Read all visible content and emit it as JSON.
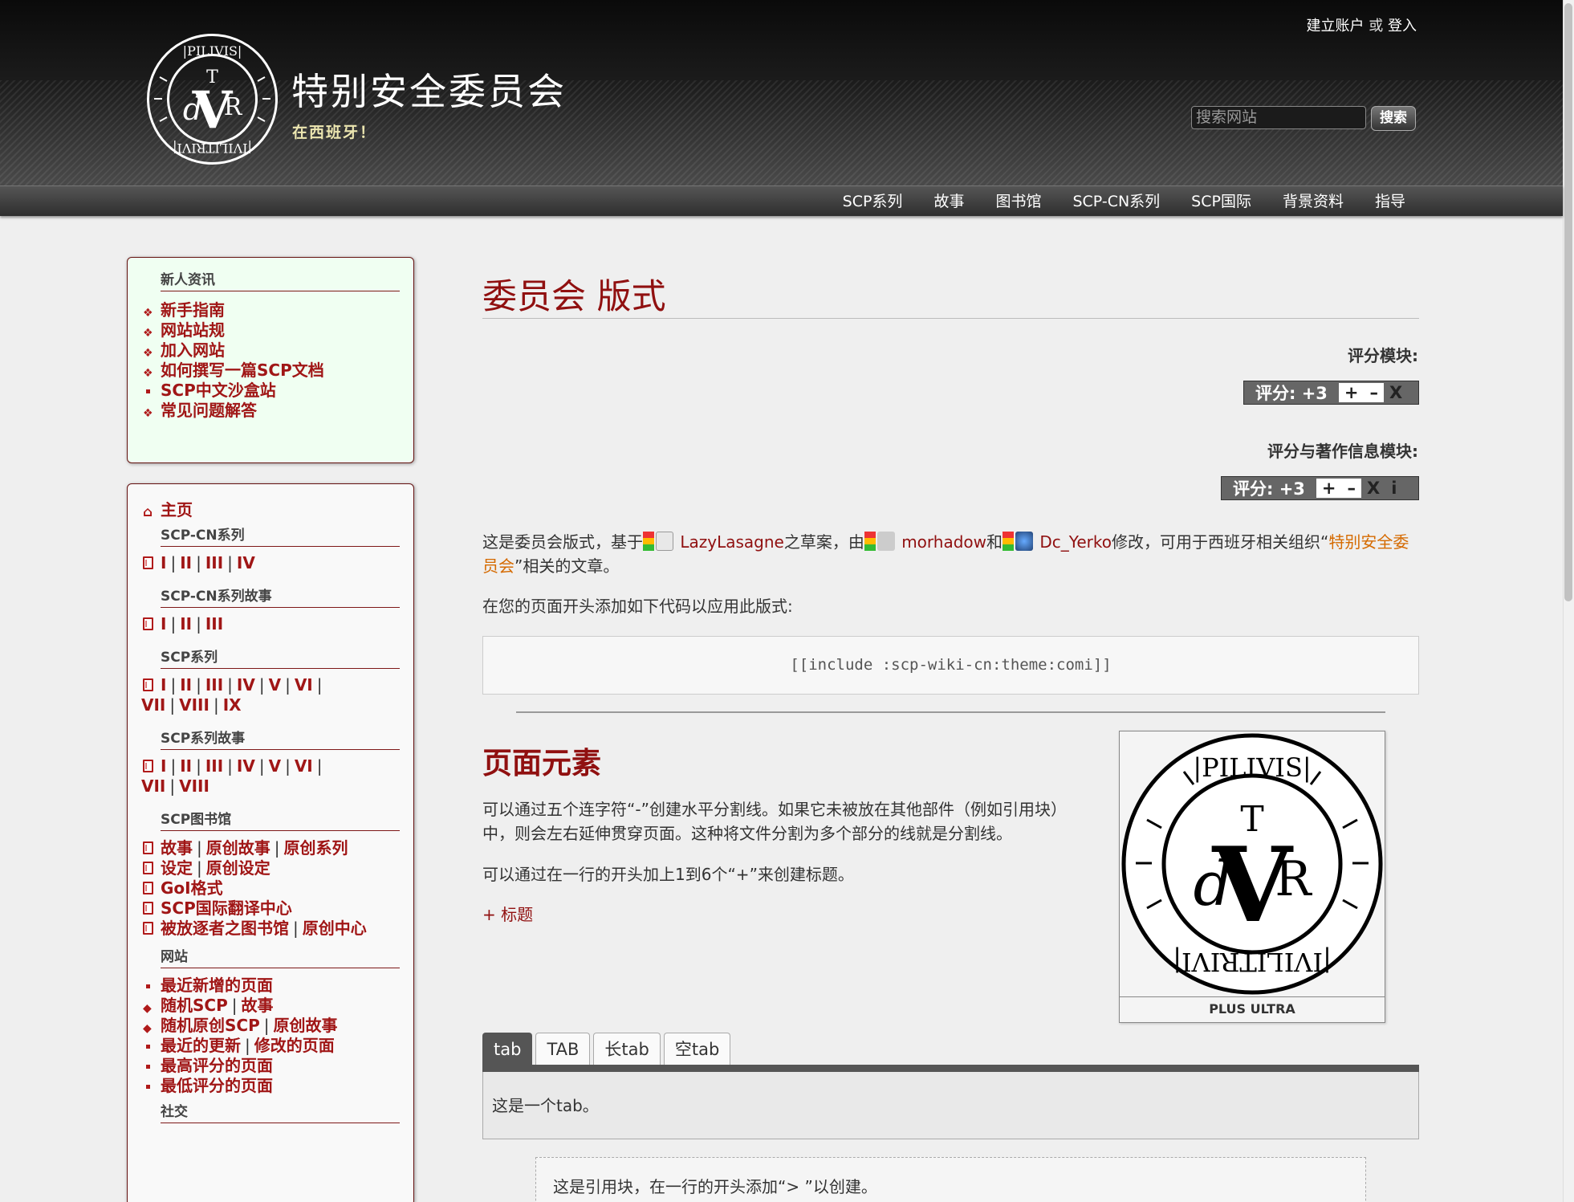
{
  "header": {
    "site_title": "特别安全委员会",
    "subtitle": "在西班牙！",
    "logo_text": "IPILIVIS · IVILITRIVI",
    "account": {
      "create": "建立账户",
      "or": "或",
      "login": "登入"
    },
    "search": {
      "placeholder": "搜索网站",
      "button": "搜索"
    }
  },
  "topnav": [
    "SCP系列",
    "故事",
    "图书馆",
    "SCP-CN系列",
    "SCP国际",
    "背景资料",
    "指导"
  ],
  "sidebar": {
    "newbie": {
      "title": "新人资讯",
      "items": [
        "新手指南",
        "网站站规",
        "加入网站",
        "如何撰写一篇SCP文档",
        "SCP中文沙盒站",
        "常见问题解答"
      ]
    },
    "home": "主页",
    "scp_cn": {
      "title": "SCP-CN系列",
      "links": [
        "I",
        "II",
        "III",
        "IV"
      ]
    },
    "scp_cn_tales": {
      "title": "SCP-CN系列故事",
      "links": [
        "I",
        "II",
        "III"
      ]
    },
    "scp": {
      "title": "SCP系列",
      "links": [
        "I",
        "II",
        "III",
        "IV",
        "V",
        "VI",
        "VII",
        "VIII",
        "IX"
      ]
    },
    "scp_tales": {
      "title": "SCP系列故事",
      "links": [
        "I",
        "II",
        "III",
        "IV",
        "V",
        "VI",
        "VII",
        "VIII"
      ]
    },
    "library": {
      "title": "SCP图书馆",
      "row1": [
        "故事",
        "原创故事",
        "原创系列"
      ],
      "row2": [
        "设定",
        "原创设定"
      ],
      "row3": "GoI格式",
      "row4": "SCP国际翻译中心",
      "row5": [
        "被放逐者之图书馆",
        "原创中心"
      ]
    },
    "site": {
      "title": "网站",
      "recent": "最近新增的页面",
      "random": [
        "随机SCP",
        "故事"
      ],
      "random_orig": [
        "随机原创SCP",
        "原创故事"
      ],
      "updates": [
        "最近的更新",
        "修改的页面"
      ],
      "top": "最高评分的页面",
      "low": "最低评分的页面"
    },
    "social": {
      "title": "社交"
    }
  },
  "main": {
    "title": "委员会 版式",
    "rating_label": "评分模块:",
    "rating_value": "评分: +3",
    "rating_credit_label": "评分与著作信息模块:",
    "rating_credit_value": "评分: +3",
    "rating_buttons": {
      "plus": "+",
      "minus": "–",
      "cancel": "X",
      "info": "i"
    },
    "intro": {
      "t1": "这是委员会版式，基于",
      "user1": "LazyLasagne",
      "t2": "之草案，由",
      "user2": "morhadow",
      "t3": "和",
      "user3": "Dc_Yerko",
      "t4": "修改，可用于西班牙相关组织“",
      "link": "特别安全委员会",
      "t5": "”相关的文章。"
    },
    "code_intro": "在您的页面开头添加如下代码以应用此版式:",
    "code": "[[include :scp-wiki-cn:theme:comi]]",
    "section_title": "页面元素",
    "hr_text": "可以通过五个连字符“-”创建水平分割线。如果它未被放在其他部件（例如引用块）中，则会左右延伸贯穿页面。这种将文件分割为多个部分的线就是分割线。",
    "heading_text": "可以通过在一行的开头加上1到6个“+”来创建标题。",
    "heading_example": "+ 标题",
    "image_caption": "PLUS ULTRA",
    "tabs": [
      "tab",
      "TAB",
      "长tab",
      "空tab"
    ],
    "tab_content": "这是一个tab。",
    "quote": "这是引用块，在一行的开头添加“> ”以创建。"
  }
}
